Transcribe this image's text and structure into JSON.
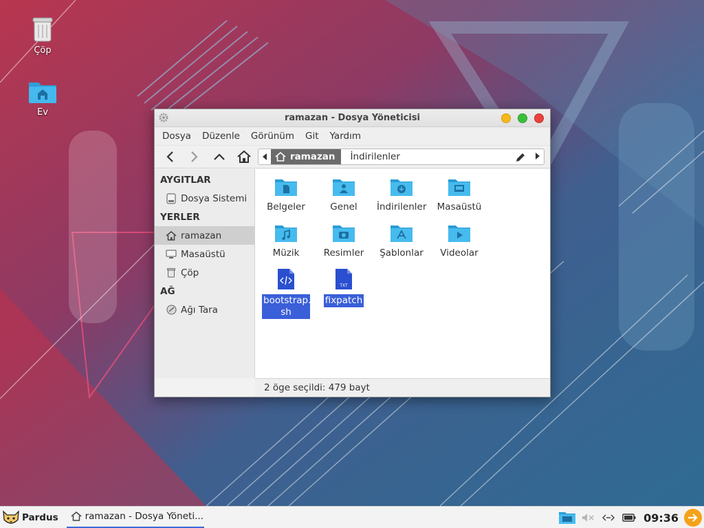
{
  "desktop": {
    "icons": [
      {
        "label": "Çöp",
        "icon": "trash-icon"
      },
      {
        "label": "Ev",
        "icon": "home-folder-icon"
      }
    ]
  },
  "window": {
    "title": "ramazan - Dosya Yöneticisi",
    "menu": [
      "Dosya",
      "Düzenle",
      "Görünüm",
      "Git",
      "Yardım"
    ],
    "path": {
      "home_crumb": "ramazan",
      "next_crumb": "İndirilenler"
    },
    "sidebar": {
      "sections": [
        {
          "title": "AYGITLAR",
          "items": [
            {
              "label": "Dosya Sistemi",
              "icon": "drive-icon"
            }
          ]
        },
        {
          "title": "YERLER",
          "items": [
            {
              "label": "ramazan",
              "icon": "home-icon",
              "active": true
            },
            {
              "label": "Masaüstü",
              "icon": "desktop-icon"
            },
            {
              "label": "Çöp",
              "icon": "trash-icon"
            }
          ]
        },
        {
          "title": "AĞ",
          "items": [
            {
              "label": "Ağı Tara",
              "icon": "network-icon"
            }
          ]
        }
      ]
    },
    "files": [
      {
        "name": "Belgeler",
        "icon": "folder-documents-icon",
        "selected": false
      },
      {
        "name": "Genel",
        "icon": "folder-public-icon",
        "selected": false
      },
      {
        "name": "İndirilenler",
        "icon": "folder-download-icon",
        "selected": false
      },
      {
        "name": "Masaüstü",
        "icon": "folder-desktop-icon",
        "selected": false
      },
      {
        "name": "Müzik",
        "icon": "folder-music-icon",
        "selected": false
      },
      {
        "name": "Resimler",
        "icon": "folder-pictures-icon",
        "selected": false
      },
      {
        "name": "Şablonlar",
        "icon": "folder-templates-icon",
        "selected": false
      },
      {
        "name": "Videolar",
        "icon": "folder-videos-icon",
        "selected": false
      },
      {
        "name": "bootstrap.",
        "name_line2": "sh",
        "icon": "script-file-icon",
        "selected": true
      },
      {
        "name": "fixpatch",
        "icon": "text-file-icon",
        "selected": true
      }
    ],
    "status": "2 öge seçildi: 479 bayt"
  },
  "taskbar": {
    "start_label": "Pardus",
    "task_label": "ramazan - Dosya Yöneti...",
    "clock": "09:36"
  },
  "colors": {
    "folder": "#36b3e8",
    "selection": "#3a5fd9",
    "script_file": "#2a4fcf"
  }
}
